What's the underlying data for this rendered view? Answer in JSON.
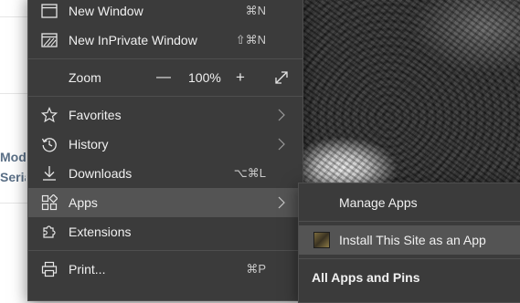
{
  "background_page": {
    "fragments": [
      "Mode",
      "Seria"
    ]
  },
  "menu": {
    "items": [
      {
        "id": "new-window",
        "label": "New Window",
        "shortcut": "⌘N",
        "icon": "window-icon"
      },
      {
        "id": "new-inprivate-window",
        "label": "New InPrivate Window",
        "shortcut": "⇧⌘N",
        "icon": "inprivate-icon"
      },
      {
        "id": "favorites",
        "label": "Favorites",
        "icon": "star-icon"
      },
      {
        "id": "history",
        "label": "History",
        "icon": "history-icon"
      },
      {
        "id": "downloads",
        "label": "Downloads",
        "shortcut": "⌥⌘L",
        "icon": "download-icon"
      },
      {
        "id": "apps",
        "label": "Apps",
        "icon": "apps-icon"
      },
      {
        "id": "extensions",
        "label": "Extensions",
        "icon": "puzzle-icon"
      },
      {
        "id": "print",
        "label": "Print...",
        "shortcut": "⌘P",
        "icon": "printer-icon"
      }
    ],
    "zoom": {
      "label": "Zoom",
      "minus": "—",
      "value": "100%",
      "plus": "+"
    }
  },
  "submenu": {
    "items": [
      {
        "label": "Manage Apps"
      },
      {
        "label": "Install This Site as an App",
        "icon": "site-app-icon"
      },
      {
        "label": "All Apps and Pins"
      }
    ]
  },
  "colors": {
    "menu_bg": "#3b3b3b",
    "menu_highlight": "#545454",
    "text": "#f0f0f0",
    "shortcut_text": "#c8c8c8"
  }
}
